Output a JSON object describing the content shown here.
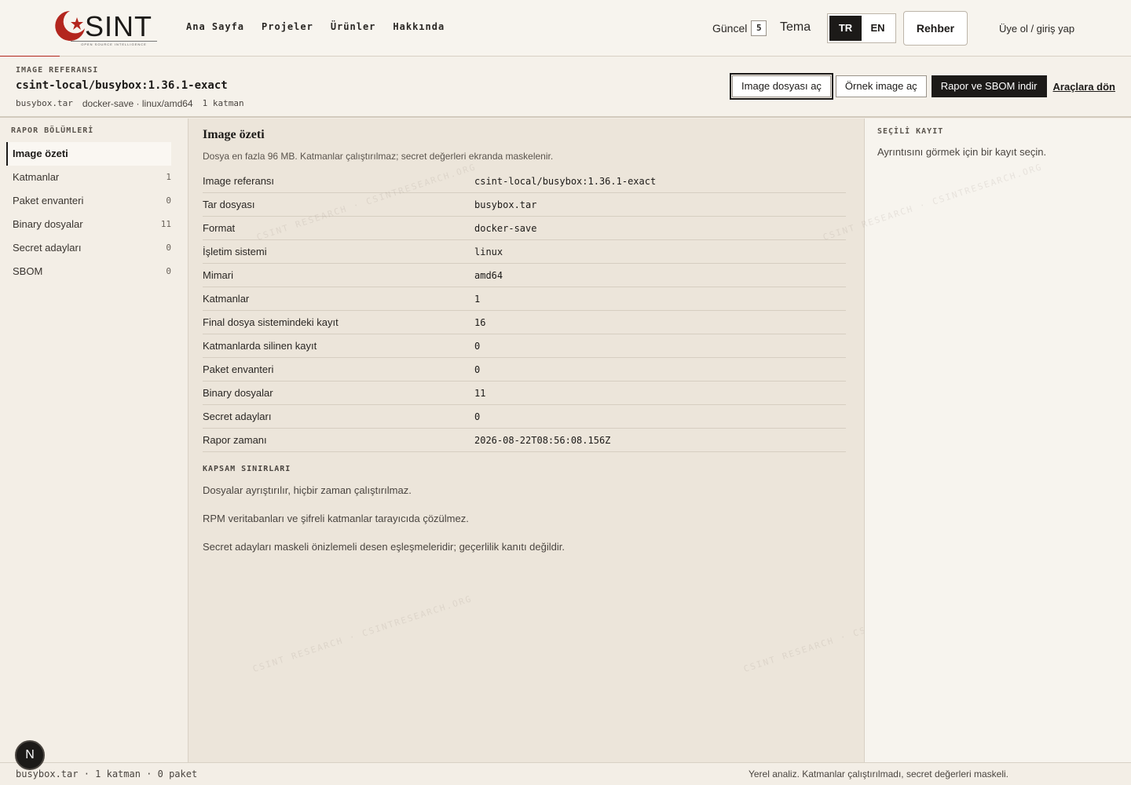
{
  "header": {
    "logo_word": "SINT",
    "logo_sub": "OPEN SOURCE INTELLIGENCE",
    "nav": [
      "Ana Sayfa",
      "Projeler",
      "Ürünler",
      "Hakkında"
    ],
    "guncel_label": "Güncel",
    "guncel_count": "5",
    "tema_label": "Tema",
    "lang_tr": "TR",
    "lang_en": "EN",
    "lang_active": "TR",
    "rehber_label": "Rehber",
    "signup_label": "Üye ol / giriş yap",
    "accent_color": "#b3261e"
  },
  "refbar": {
    "kicker": "IMAGE REFERANSI",
    "title": "csint-local/busybox:1.36.1-exact",
    "file": "busybox.tar",
    "format_arch": "docker-save · linux/amd64",
    "layers": "1 katman",
    "btn_open": "Image dosyası aç",
    "btn_sample": "Örnek image aç",
    "btn_download": "Rapor ve SBOM indir",
    "link_back": "Araçlara dön"
  },
  "sidebar": {
    "title": "RAPOR BÖLÜMLERİ",
    "items": [
      {
        "label": "Image özeti",
        "count": ""
      },
      {
        "label": "Katmanlar",
        "count": "1"
      },
      {
        "label": "Paket envanteri",
        "count": "0"
      },
      {
        "label": "Binary dosyalar",
        "count": "11"
      },
      {
        "label": "Secret adayları",
        "count": "0"
      },
      {
        "label": "SBOM",
        "count": "0"
      }
    ]
  },
  "main": {
    "title": "Image özeti",
    "note": "Dosya en fazla 96 MB. Katmanlar çalıştırılmaz; secret değerleri ekranda maskelenir.",
    "rows": [
      {
        "key": "Image referansı",
        "value": "csint-local/busybox:1.36.1-exact"
      },
      {
        "key": "Tar dosyası",
        "value": "busybox.tar"
      },
      {
        "key": "Format",
        "value": "docker-save"
      },
      {
        "key": "İşletim sistemi",
        "value": "linux"
      },
      {
        "key": "Mimari",
        "value": "amd64"
      },
      {
        "key": "Katmanlar",
        "value": "1"
      },
      {
        "key": "Final dosya sistemindeki kayıt",
        "value": "16"
      },
      {
        "key": "Katmanlarda silinen kayıt",
        "value": "0"
      },
      {
        "key": "Paket envanteri",
        "value": "0"
      },
      {
        "key": "Binary dosyalar",
        "value": "11"
      },
      {
        "key": "Secret adayları",
        "value": "0"
      },
      {
        "key": "Rapor zamanı",
        "value": "2026-08-22T08:56:08.156Z"
      }
    ],
    "scope_title": "KAPSAM SINIRLARI",
    "scope": [
      "Dosyalar ayrıştırılır, hiçbir zaman çalıştırılmaz.",
      "RPM veritabanları ve şifreli katmanlar tarayıcıda çözülmez.",
      "Secret adayları maskeli önizlemeli desen eşleşmeleridir; geçerlilik kanıtı değildir."
    ]
  },
  "detail": {
    "title": "SEÇİLİ KAYIT",
    "text": "Ayrıntısını görmek için bir kayıt seçin."
  },
  "watermark": "CSINT RESEARCH · CSINTRESEARCH.ORG",
  "status": {
    "left": "busybox.tar · 1 katman · 0 paket",
    "right": "Yerel analiz. Katmanlar çalıştırılmadı, secret değerleri maskeli.",
    "badge": "N"
  }
}
